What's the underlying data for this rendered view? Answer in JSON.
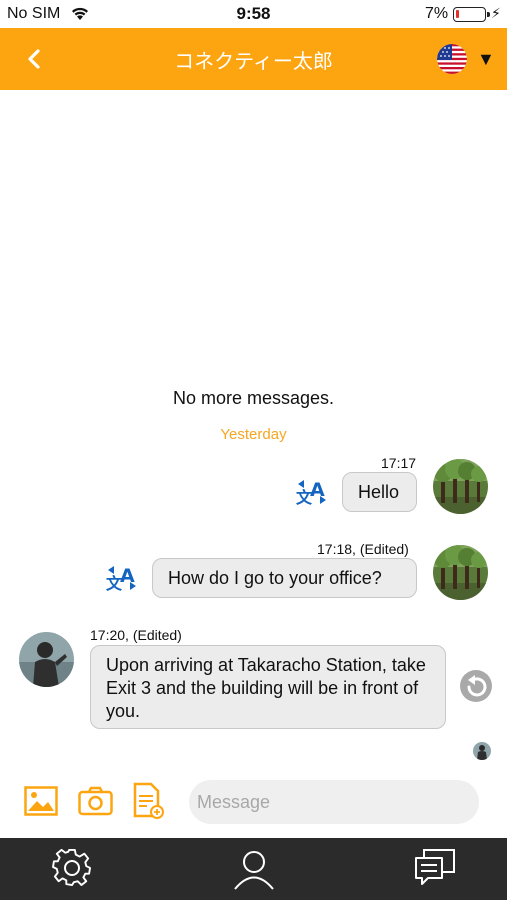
{
  "status_bar": {
    "carrier": "No SIM",
    "time": "9:58",
    "battery_percent": "7%",
    "battery_level": 0.07,
    "icons": [
      "wifi-icon",
      "battery-icon",
      "charging-icon"
    ]
  },
  "header": {
    "title": "コネクティー太郎",
    "back_icon": "chevron-left-icon",
    "language_icon": "us-flag-icon",
    "dropdown_glyph": "▼",
    "background_color": "#fca510"
  },
  "conversation": {
    "no_more_text": "No more messages.",
    "date_separator": "Yesterday",
    "messages": [
      {
        "time": "17:17",
        "text": "Hello",
        "side": "outgoing"
      },
      {
        "time": "17:18, (Edited)",
        "text": "How do I go to your office?",
        "side": "outgoing"
      },
      {
        "time": "17:20, (Edited)",
        "text": "Upon arriving at Takaracho Station, take Exit 3 and the building will be in front of you.",
        "side": "incoming"
      }
    ]
  },
  "composer": {
    "placeholder": "Message",
    "value": "",
    "tools": [
      "image-icon",
      "camera-icon",
      "document-icon"
    ]
  },
  "tab_bar": {
    "tabs": [
      "settings-icon",
      "profile-icon",
      "chat-icon"
    ]
  },
  "colors": {
    "accent": "#fca510",
    "date_separator": "#f5a623",
    "translate_icon": "#1565c0",
    "tab_bar": "#2b2b2b"
  }
}
